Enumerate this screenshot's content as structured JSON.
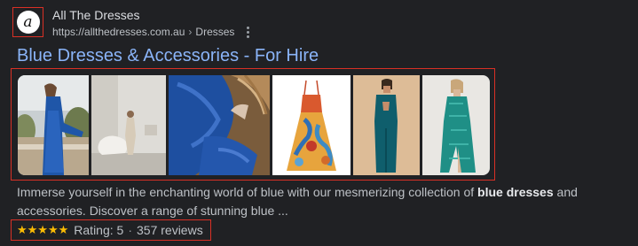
{
  "site": {
    "favicon_letter": "a",
    "name": "All The Dresses",
    "url": "https://allthedresses.com.au",
    "breadcrumb_sep": "›",
    "breadcrumb": "Dresses"
  },
  "result": {
    "title": "Blue Dresses & Accessories - For Hire",
    "snippet_part1": "Immerse yourself in the enchanting world of blue with our mesmerizing collection of ",
    "snippet_bold": "blue dresses",
    "snippet_part2": " and accessories. Discover a range of stunning blue ..."
  },
  "thumbnails": [
    {
      "name": "model-blue-dress-terrace"
    },
    {
      "name": "model-white-room-sofa"
    },
    {
      "name": "blue-fabric-wicker-chair"
    },
    {
      "name": "paisley-print-maxi-dress"
    },
    {
      "name": "teal-cutout-gown"
    },
    {
      "name": "teal-sequin-gown"
    }
  ],
  "rating": {
    "stars": "★★★★★",
    "value": 5,
    "label": "Rating: 5",
    "dot": "·",
    "reviews": "357 reviews"
  },
  "colors": {
    "background": "#202124",
    "title_link": "#8ab4f8",
    "highlight_box": "#d93025",
    "star": "#fbbc04"
  }
}
